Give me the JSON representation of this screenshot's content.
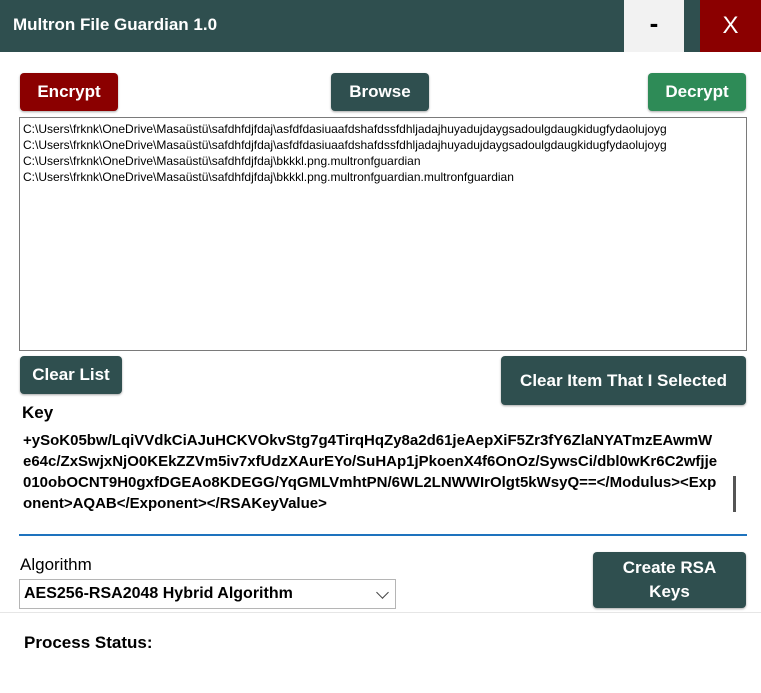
{
  "window": {
    "title": "Multron File Guardian 1.0",
    "minimize_label": "-",
    "close_label": "X"
  },
  "toolbar": {
    "encrypt_label": "Encrypt",
    "browse_label": "Browse",
    "decrypt_label": "Decrypt"
  },
  "file_list": {
    "items": [
      "C:\\Users\\frknk\\OneDrive\\Masaüstü\\safdhfdjfdaj\\asfdfdasiuaafdshafdssfdhljadajhuyadujdaygsadoulgdaugkidugfydaolujoyg",
      "C:\\Users\\frknk\\OneDrive\\Masaüstü\\safdhfdjfdaj\\asfdfdasiuaafdshafdssfdhljadajhuyadujdaygsadoulgdaugkidugfydaolujoyg",
      "C:\\Users\\frknk\\OneDrive\\Masaüstü\\safdhfdjfdaj\\bkkkl.png.multronfguardian",
      "C:\\Users\\frknk\\OneDrive\\Masaüstü\\safdhfdjfdaj\\bkkkl.png.multronfguardian.multronfguardian"
    ]
  },
  "list_actions": {
    "clear_list_label": "Clear List",
    "clear_selected_label": "Clear Item That I Selected"
  },
  "key": {
    "label": "Key",
    "value": "+ySoK05bw/LqiVVdkCiAJuHCKVOkvStg7g4TirqHqZy8a2d61jeAepXiF5Zr3fY6ZlaNYATmzEAwmWe64c/ZxSwjxNjO0KEkZZVm5iv7xfUdzXAurEYo/SuHAp1jPkoenX4f6OnOz/SywsCi/dbl0wKr6C2wfjje010obOCNT9H0gxfDGEAo8KDEGG/YqGMLVmhtPN/6WL2LNWWIrOlgt5kWsyQ==</Modulus><Exponent>AQAB</Exponent></RSAKeyValue>"
  },
  "algorithm": {
    "label": "Algorithm",
    "selected": "AES256-RSA2048 Hybrid Algorithm",
    "create_keys_line1": "Create RSA",
    "create_keys_line2": "Keys"
  },
  "status": {
    "label": "Process Status:"
  },
  "colors": {
    "titlebar": "#2f4f4f",
    "encrypt": "#8b0000",
    "decrypt": "#2e8b57",
    "close": "#8b0000",
    "accent_underline": "#1e73be"
  }
}
